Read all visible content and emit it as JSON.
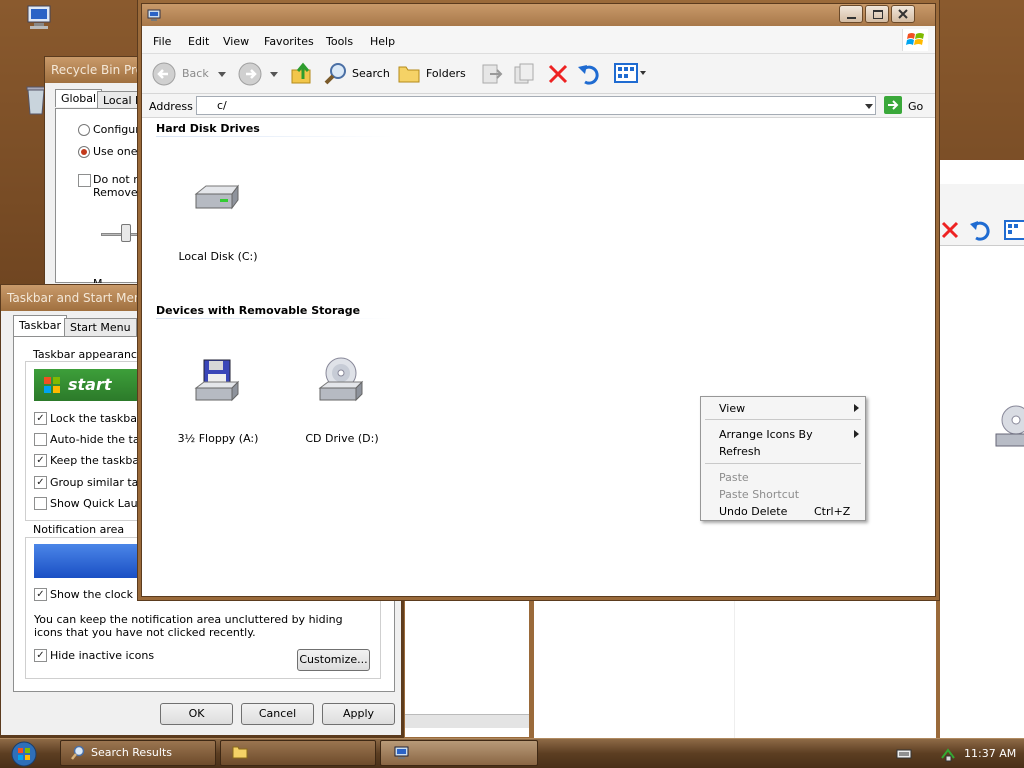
{
  "colors": {
    "accent": "#0a4fb4",
    "titlebar": "#a0703f",
    "desktop": "#6e4420"
  },
  "explorer": {
    "menu": [
      "File",
      "Edit",
      "View",
      "Favorites",
      "Tools",
      "Help"
    ],
    "toolbar": {
      "back": "Back",
      "search": "Search",
      "folders": "Folders"
    },
    "address_label": "Address",
    "address_value": "c/",
    "go": "Go",
    "sections": {
      "hdd": "Hard Disk Drives",
      "removable": "Devices with Removable Storage"
    },
    "items": {
      "local_disk": "Local Disk (C:)",
      "floppy": "3½ Floppy (A:)",
      "cd_drive": "CD Drive (D:)"
    }
  },
  "context_menu": {
    "view": "View",
    "arrange": "Arrange Icons By",
    "refresh": "Refresh",
    "paste": "Paste",
    "paste_shortcut": "Paste Shortcut",
    "undo_delete": "Undo Delete",
    "undo_shortcut": "Ctrl+Z"
  },
  "recycle_dialog": {
    "title": "Recycle Bin Prop",
    "tabs": [
      "Global",
      "Local Di"
    ],
    "opt_configure": "Configure",
    "opt_use_one": "Use one s",
    "do_not_move": "Do not mo",
    "remove": "Remove f",
    "max_partial": "M"
  },
  "taskbar_dialog": {
    "title": "Taskbar and Start Menu P",
    "tabs": [
      "Taskbar",
      "Start Menu"
    ],
    "appearance_label": "Taskbar appearance",
    "start_label": "start",
    "lock": "Lock the taskbar",
    "autohide": "Auto-hide the taskb",
    "keep": "Keep the taskbar o",
    "group": "Group similar taskb",
    "quick": "Show Quick Launc",
    "notification_label": "Notification area",
    "clock": "Show the clock",
    "info": "You can keep the notification area uncluttered by hiding icons that you have not clicked recently.",
    "hide_inactive": "Hide inactive icons",
    "customize": "Customize...",
    "ok": "OK",
    "cancel": "Cancel",
    "apply": "Apply"
  },
  "taskbar": {
    "search_results": "Search Results",
    "clock": "11:37 AM"
  }
}
